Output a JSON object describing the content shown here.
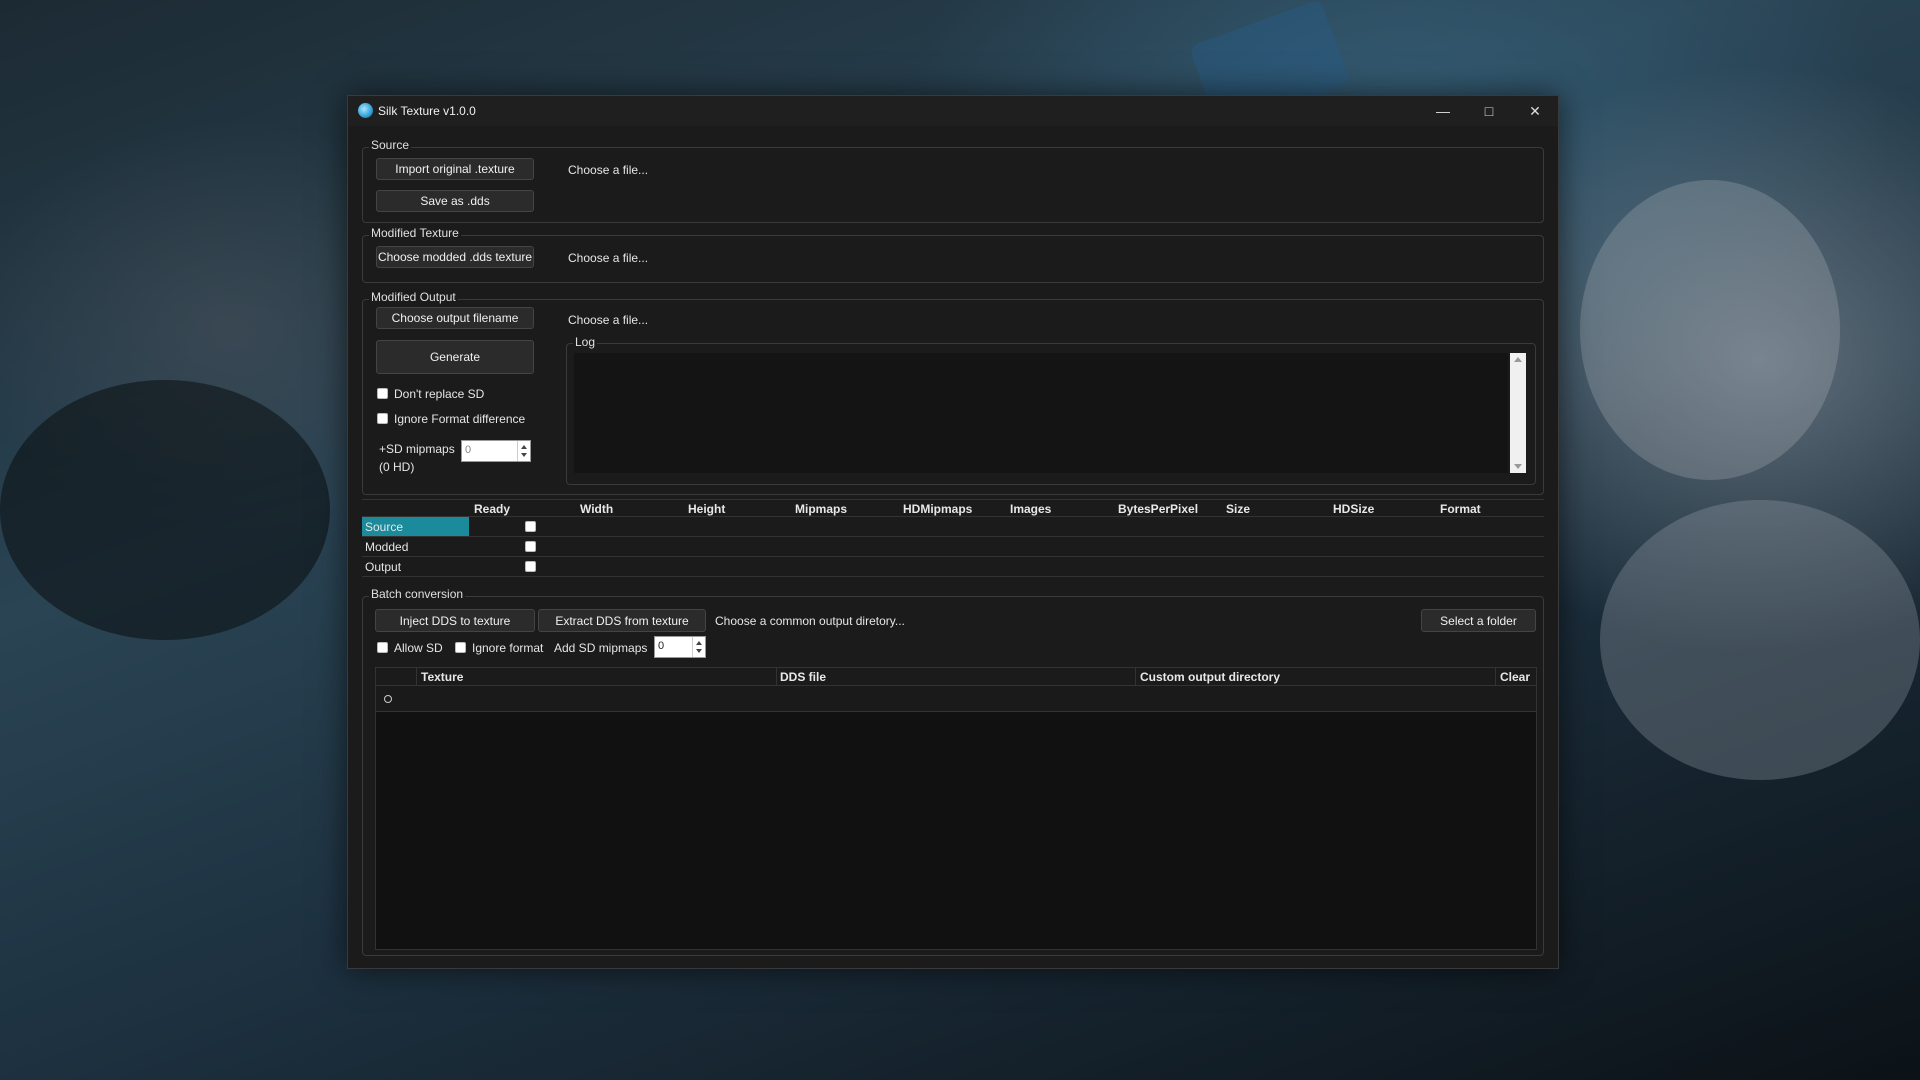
{
  "window": {
    "title": "Silk Texture v1.0.0"
  },
  "source": {
    "label": "Source",
    "import_button": "Import original .texture",
    "save_button": "Save as .dds",
    "file_text": "Choose a file..."
  },
  "modified_texture": {
    "label": "Modified Texture",
    "choose_button": "Choose modded .dds texture",
    "file_text": "Choose a file..."
  },
  "modified_output": {
    "label": "Modified Output",
    "choose_button": "Choose output filename",
    "file_text": "Choose a file...",
    "generate_button": "Generate",
    "dont_replace_sd": "Don't replace SD",
    "ignore_format": "Ignore Format difference",
    "sd_mipmaps_label_1": "+SD mipmaps",
    "sd_mipmaps_label_2": "(0 HD)",
    "sd_mipmaps_value": "0",
    "log_label": "Log"
  },
  "info_grid": {
    "columns": [
      "Ready",
      "Width",
      "Height",
      "Mipmaps",
      "HDMipmaps",
      "Images",
      "BytesPerPixel",
      "Size",
      "HDSize",
      "Format"
    ],
    "rows": [
      "Source",
      "Modded",
      "Output"
    ]
  },
  "batch": {
    "label": "Batch conversion",
    "inject_button": "Inject DDS to texture",
    "extract_button": "Extract DDS from texture",
    "output_dir_text": "Choose a common output diretory...",
    "select_folder_button": "Select a folder",
    "allow_sd": "Allow SD",
    "ignore_format": "Ignore format",
    "add_sd_mipmaps": "Add SD mipmaps",
    "add_sd_mipmaps_value": "0",
    "table_headers": [
      "Texture",
      "DDS file",
      "Custom output directory",
      "Clear"
    ]
  },
  "colors": {
    "selected_row": "#1b8a9a",
    "window_bg": "#1b1b1b"
  }
}
